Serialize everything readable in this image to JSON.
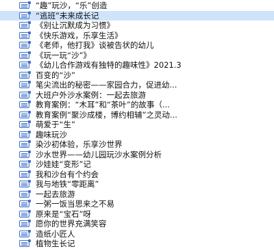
{
  "file_list": {
    "selected_index": 1,
    "items": [
      {
        "icon": "document-icon",
        "name": "“趣”玩沙，“乐”创造"
      },
      {
        "icon": "document-icon",
        "name": "“逃班”未来成长记"
      },
      {
        "icon": "document-icon",
        "name": "《别让沉默成为习惯》"
      },
      {
        "icon": "document-icon",
        "name": "《快乐游戏，乐享生活》"
      },
      {
        "icon": "document-icon",
        "name": "《老师，他打我》谈被告状的幼儿"
      },
      {
        "icon": "document-icon",
        "name": "《玩一玩“沙”》"
      },
      {
        "icon": "document-icon",
        "name": "《幼儿合作游戏有独特的趣味性》2021.3"
      },
      {
        "icon": "document-icon",
        "name": "百变的“沙”"
      },
      {
        "icon": "document-icon",
        "name": "笔尖流出的秘密——家园合力，促进幼..."
      },
      {
        "icon": "document-icon",
        "name": "大班户外沙水案例：一起去旅游"
      },
      {
        "icon": "document-icon",
        "name": "教育案例：“木耳”和“茶叶”的故事（..."
      },
      {
        "icon": "document-icon",
        "name": "教育案例“聚沙成楼，博约相辅”之灵动..."
      },
      {
        "icon": "document-icon",
        "name": "萌爱于“生”"
      },
      {
        "icon": "document-icon",
        "name": "趣味玩沙"
      },
      {
        "icon": "document-icon",
        "name": "染沙初体验，乐享沙世界"
      },
      {
        "icon": "document-icon",
        "name": "沙水世界——幼儿园玩沙水案例分析"
      },
      {
        "icon": "document-icon",
        "name": "沙娃娃“变形”记"
      },
      {
        "icon": "document-icon",
        "name": "我和沙台有个约会"
      },
      {
        "icon": "document-icon",
        "name": "我与地铁“零距离”"
      },
      {
        "icon": "document-icon",
        "name": "一起去旅游"
      },
      {
        "icon": "document-icon",
        "name": "一粥一饭当思来之不易"
      },
      {
        "icon": "document-icon",
        "name": "原来是“宝石”呀"
      },
      {
        "icon": "document-icon",
        "name": "愿你的世界充满笑容"
      },
      {
        "icon": "document-icon",
        "name": "造纸小匠人"
      },
      {
        "icon": "document-icon",
        "name": "植物生长记"
      }
    ]
  }
}
